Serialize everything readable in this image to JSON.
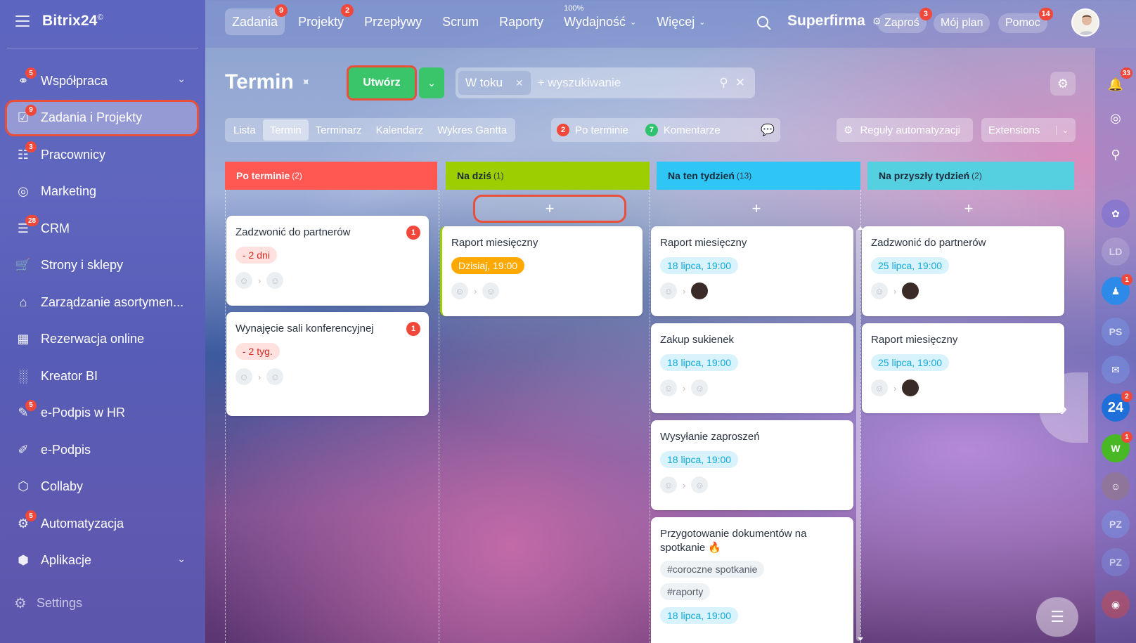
{
  "app": {
    "name": "Bitrix24",
    "mark": "©"
  },
  "sidebar": {
    "items": [
      {
        "label": "Współpraca",
        "badge": "5",
        "chevron": true,
        "icon": "collaboration-icon"
      },
      {
        "label": "Zadania i Projekty",
        "badge": "9",
        "active": true,
        "icon": "tasks-icon"
      },
      {
        "label": "Pracownicy",
        "badge": "3",
        "icon": "employees-icon"
      },
      {
        "label": "Marketing",
        "icon": "marketing-icon"
      },
      {
        "label": "CRM",
        "badge": "28",
        "icon": "crm-icon"
      },
      {
        "label": "Strony i sklepy",
        "icon": "cart-icon"
      },
      {
        "label": "Zarządzanie asortymen...",
        "icon": "inventory-icon"
      },
      {
        "label": "Rezerwacja online",
        "icon": "calendar-icon"
      },
      {
        "label": "Kreator BI",
        "icon": "bar-chart-icon"
      },
      {
        "label": "e-Podpis w HR",
        "badge": "5",
        "icon": "signature-hr-icon"
      },
      {
        "label": "e-Podpis",
        "icon": "signature-icon"
      },
      {
        "label": "Collaby",
        "icon": "collaby-icon"
      },
      {
        "label": "Automatyzacja",
        "badge": "5",
        "icon": "robot-icon"
      },
      {
        "label": "Aplikacje",
        "chevron": true,
        "icon": "apps-icon"
      }
    ],
    "settings_label": "Settings"
  },
  "topnav": {
    "tabs": [
      {
        "label": "Zadania",
        "badge": "9",
        "active": true
      },
      {
        "label": "Projekty",
        "badge": "2"
      },
      {
        "label": "Przepływy"
      },
      {
        "label": "Scrum"
      },
      {
        "label": "Raporty"
      },
      {
        "label": "Wydajność",
        "sup": "100%",
        "caret": true
      },
      {
        "label": "Więcej",
        "caret": true
      }
    ],
    "company": "Superfirma",
    "invite": {
      "label": "Zaproś",
      "badge": "3"
    },
    "my_plan": "Mój plan",
    "help": {
      "label": "Pomoc",
      "badge": "14"
    }
  },
  "page": {
    "title": "Termin",
    "create_label": "Utwórz",
    "filter": {
      "chip": "W toku",
      "placeholder": "+ wyszukiwanie"
    }
  },
  "views": {
    "tabs": [
      "Lista",
      "Termin",
      "Terminarz",
      "Kalendarz",
      "Wykres Gantta"
    ],
    "active": "Termin",
    "counters": [
      {
        "count": "2",
        "label": "Po terminie",
        "color": "#f0483b"
      },
      {
        "count": "7",
        "label": "Komentarze",
        "color": "#2fc26e"
      }
    ],
    "automation": "Reguły automatyzacji",
    "extensions": "Extensions"
  },
  "columns": [
    {
      "title": "Po terminie",
      "count": "(2)",
      "color": "#ff5752",
      "cards": [
        {
          "title": "Zadzwonić do partnerów",
          "badge": "1",
          "deadline": "- 2 dni",
          "kind": "overdue"
        },
        {
          "title": "Wynajęcie sali konferencyjnej",
          "badge": "1",
          "deadline": "- 2 tyg.",
          "kind": "overdue"
        }
      ]
    },
    {
      "title": "Na dziś",
      "count": "(1)",
      "color": "#9dcf00",
      "cards": [
        {
          "title": "Raport miesięczny",
          "deadline": "Dzisiaj, 19:00",
          "kind": "today"
        }
      ]
    },
    {
      "title": "Na ten tydzień",
      "count": "(13)",
      "color": "#2fc6f6",
      "cards": [
        {
          "title": "Raport miesięczny",
          "deadline": "18 lipca, 19:00",
          "kind": "future"
        },
        {
          "title": "Zakup sukienek",
          "deadline": "18 lipca, 19:00",
          "kind": "future"
        },
        {
          "title": "Wysyłanie zaproszeń",
          "deadline": "18 lipca, 19:00",
          "kind": "future"
        },
        {
          "title": "Przygotowanie dokumentów na spotkanie",
          "tags": [
            "#coroczne spotkanie",
            "#raporty"
          ],
          "deadline": "18 lipca, 19:00",
          "kind": "future"
        }
      ]
    },
    {
      "title": "Na przyszły tydzień",
      "count": "(2)",
      "color": "#55d0e0",
      "cards": [
        {
          "title": "Zadzwonić do partnerów",
          "deadline": "25 lipca, 19:00",
          "kind": "future"
        },
        {
          "title": "Raport miesięczny",
          "deadline": "25 lipca, 19:00",
          "kind": "future"
        }
      ]
    }
  ],
  "rail": {
    "notifications_badge": "33",
    "items": [
      {
        "label": "PS"
      },
      {
        "label": "24",
        "badge": "2"
      },
      {
        "label": "W",
        "badge": "1"
      },
      {
        "label": "PZ"
      },
      {
        "label": "PZ"
      },
      {
        "label": "LD"
      }
    ]
  }
}
